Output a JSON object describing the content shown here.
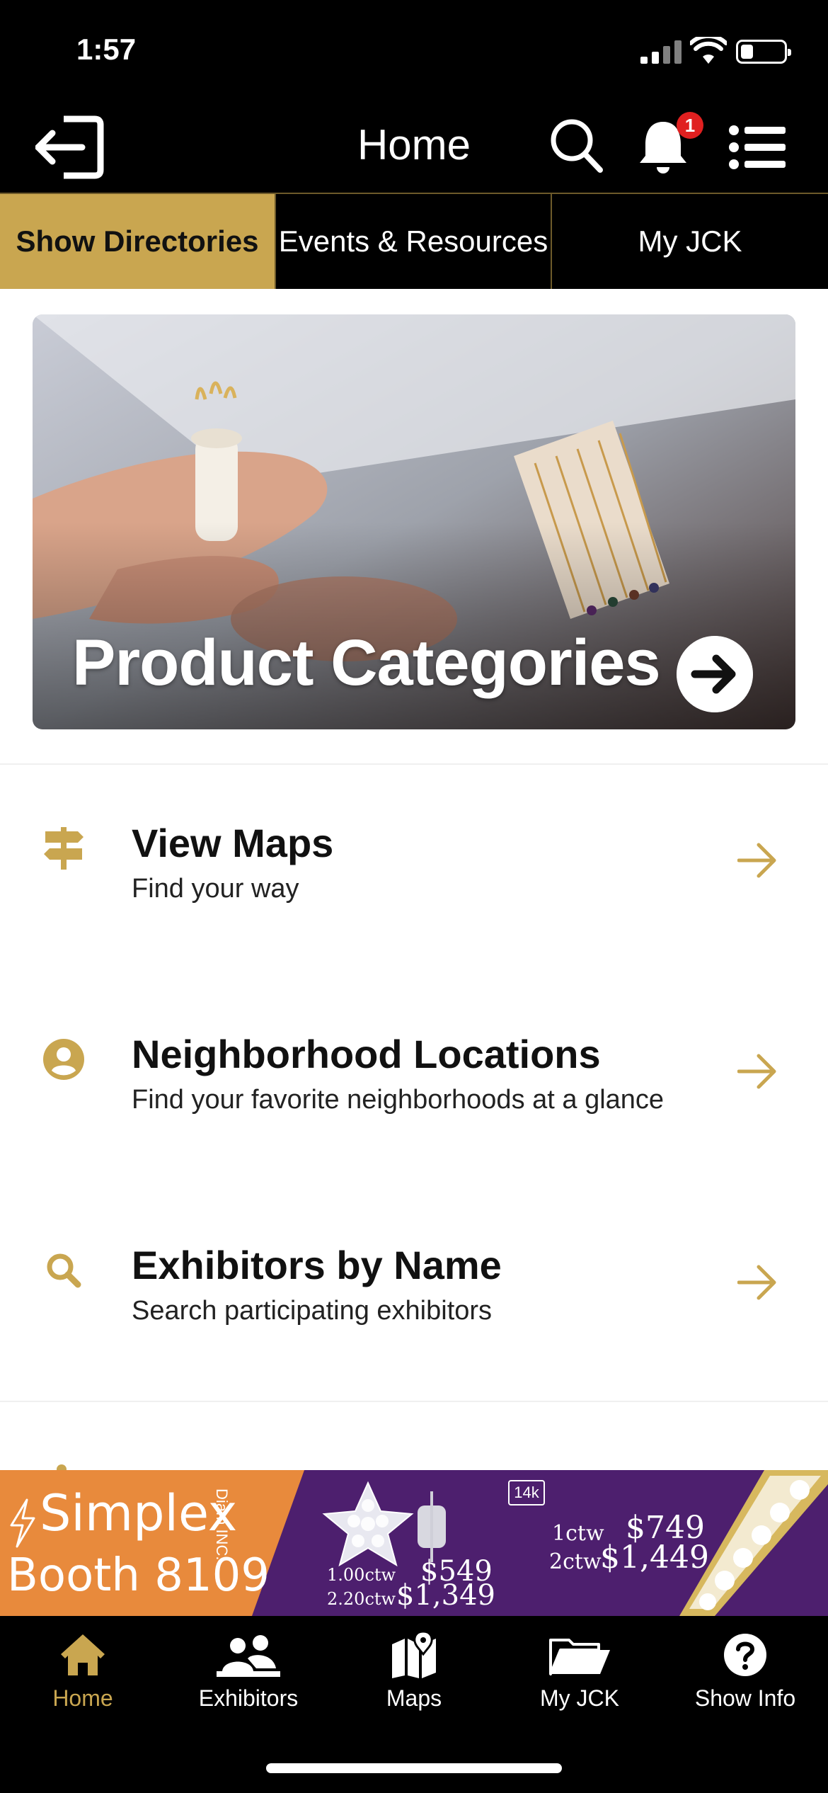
{
  "status": {
    "time": "1:57",
    "battery_level": 0.3
  },
  "nav": {
    "title": "Home",
    "notification_count": "1"
  },
  "top_tabs": [
    {
      "label": "Show Directories",
      "active": true
    },
    {
      "label": "Events & Resources",
      "active": false
    },
    {
      "label": "My JCK",
      "active": false
    }
  ],
  "hero": {
    "title": "Product Categories"
  },
  "list": [
    {
      "title": "View Maps",
      "subtitle": "Find your way",
      "icon": "signpost-icon"
    },
    {
      "title": "Neighborhood Locations",
      "subtitle": "Find your favorite neighborhoods at a glance",
      "icon": "user-circle-icon"
    },
    {
      "title": "Exhibitors by Name",
      "subtitle": "Search participating exhibitors",
      "icon": "search-icon"
    }
  ],
  "ad": {
    "brand": "Simplex",
    "brand_small": "Diam INC.",
    "booth": "Booth 8109",
    "karat": "14k",
    "left_prices": {
      "ctw1": "1.00ctw",
      "price1": "$549",
      "ctw2": "2.20ctw",
      "price2": "$1,349"
    },
    "right_prices": {
      "ctw1": "1ctw",
      "price1": "$749",
      "ctw2": "2ctw",
      "price2": "$1,449"
    }
  },
  "tab_bar": [
    {
      "label": "Home",
      "icon": "home-icon",
      "active": true
    },
    {
      "label": "Exhibitors",
      "icon": "exhibitors-icon",
      "active": false
    },
    {
      "label": "Maps",
      "icon": "map-icon",
      "active": false
    },
    {
      "label": "My JCK",
      "icon": "folder-icon",
      "active": false
    },
    {
      "label": "Show Info",
      "icon": "question-icon",
      "active": false
    }
  ],
  "colors": {
    "accent": "#c9a650",
    "badge": "#e02020",
    "ad_orange": "#e88a3c",
    "ad_purple": "#4d1f6e"
  }
}
